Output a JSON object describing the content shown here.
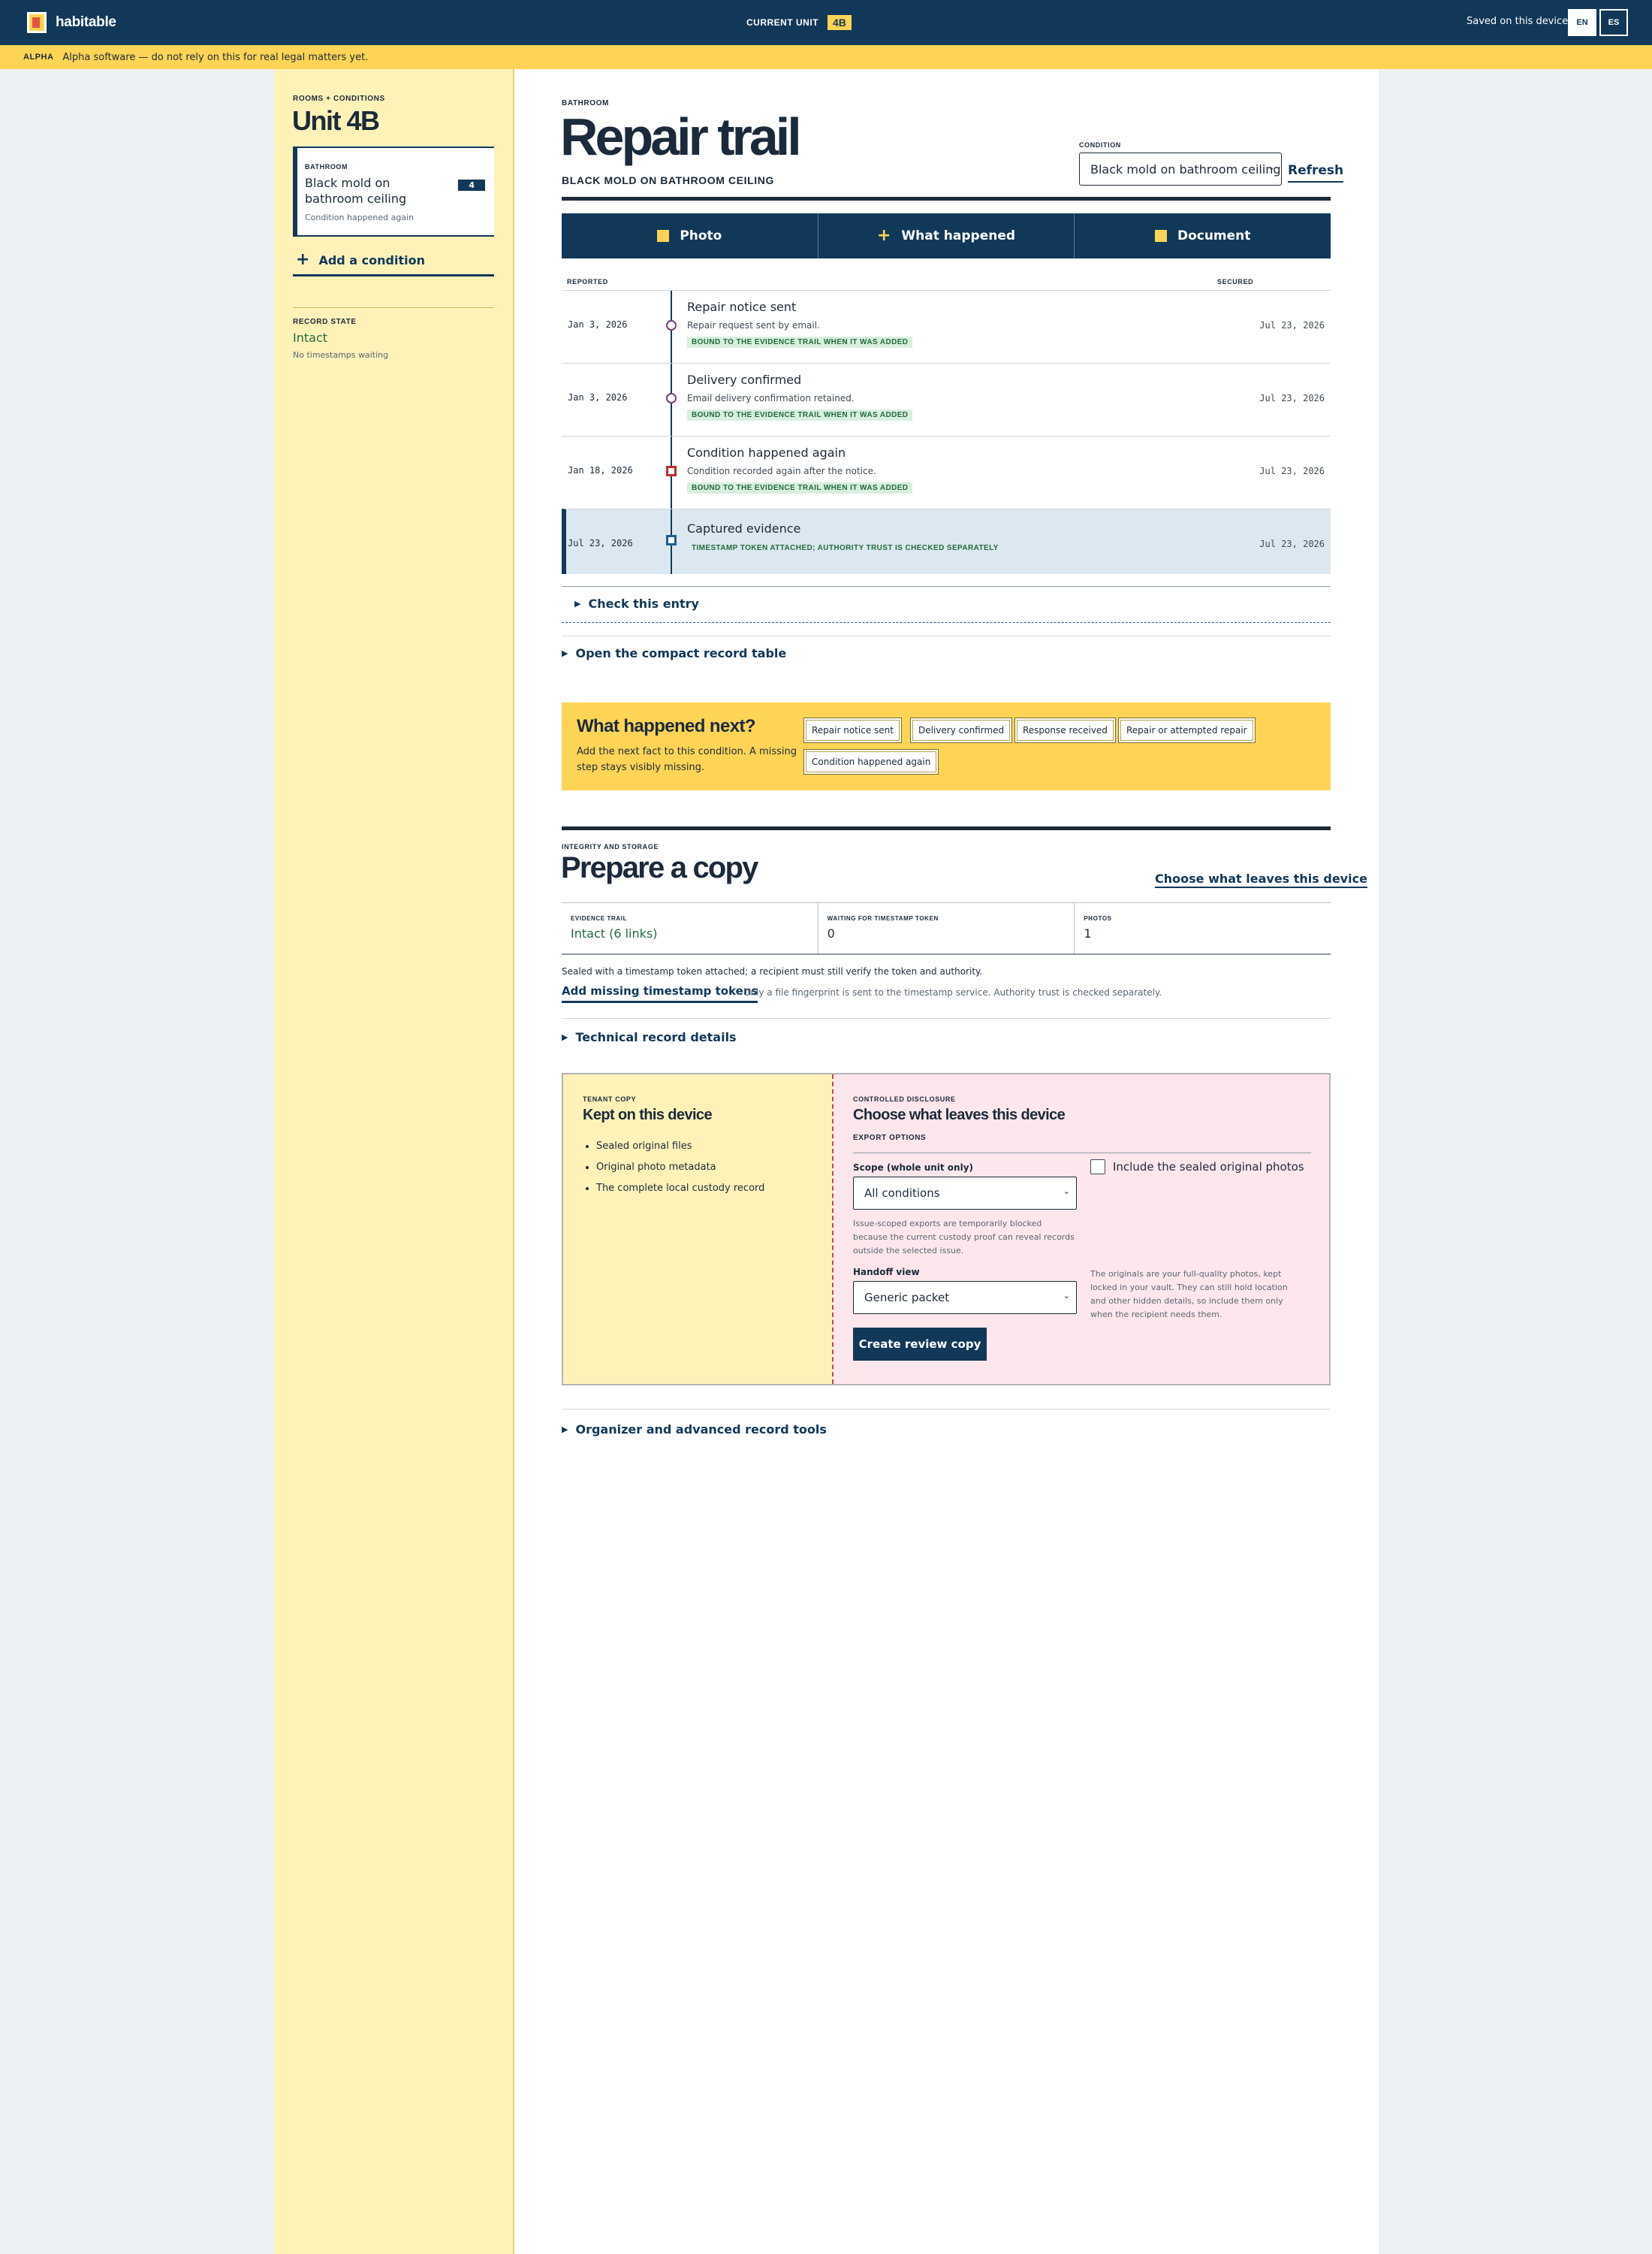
{
  "topbar": {
    "brand": "habitable",
    "current_unit_label": "CURRENT UNIT",
    "current_unit": "4B",
    "saved": "Saved on this device",
    "lang_en": "EN",
    "lang_es": "ES"
  },
  "alpha": {
    "tag": "ALPHA",
    "message": "Alpha software — do not rely on this for real legal matters yet."
  },
  "sidebar": {
    "eyebrow": "ROOMS + CONDITIONS",
    "unit_title": "Unit 4B",
    "condition_card": {
      "room": "BATHROOM",
      "title": "Black mold on bathroom ceiling",
      "status": "Condition happened again",
      "count": "4"
    },
    "add_condition": "Add a condition",
    "record_state_label": "RECORD STATE",
    "record_state": "Intact",
    "record_note": "No timestamps waiting"
  },
  "main": {
    "eyebrow": "BATHROOM",
    "title": "Repair trail",
    "subtitle": "BLACK MOLD ON BATHROOM CEILING",
    "condition_label": "CONDITION",
    "condition_value": "Black mold on bathroom ceiling",
    "refresh": "Refresh",
    "actions": {
      "photo": "Photo",
      "what_happened": "What happened",
      "document": "Document"
    },
    "timeline_headers": {
      "reported": "REPORTED",
      "secured": "SECURED"
    },
    "timeline": [
      {
        "date": "Jan 3, 2026",
        "title": "Repair notice sent",
        "desc": "Repair request sent by email.",
        "badge": "BOUND TO THE EVIDENCE TRAIL WHEN IT WAS ADDED",
        "secured": "Jul 23, 2026"
      },
      {
        "date": "Jan 3, 2026",
        "title": "Delivery confirmed",
        "desc": "Email delivery confirmation retained.",
        "badge": "BOUND TO THE EVIDENCE TRAIL WHEN IT WAS ADDED",
        "secured": "Jul 23, 2026"
      },
      {
        "date": "Jan 18, 2026",
        "title": "Condition happened again",
        "desc": "Condition recorded again after the notice.",
        "badge": "BOUND TO THE EVIDENCE TRAIL WHEN IT WAS ADDED",
        "secured": "Jul 23, 2026"
      },
      {
        "date": "Jul 23, 2026",
        "title": "Captured evidence",
        "badge": "TIMESTAMP TOKEN ATTACHED; AUTHORITY TRUST IS CHECKED SEPARATELY",
        "secured": "Jul 23, 2026"
      }
    ],
    "check_entry": "Check this entry",
    "compact_table": "Open the compact record table"
  },
  "next": {
    "title": "What happened next?",
    "body": "Add the next fact to this condition. A missing step stays visibly missing.",
    "chips": [
      "Repair notice sent",
      "Delivery confirmed",
      "Response received",
      "Repair or attempted repair",
      "Condition happened again"
    ]
  },
  "copy": {
    "eyebrow": "INTEGRITY AND STORAGE",
    "title": "Prepare a copy",
    "choose_link": "Choose what leaves this device",
    "stats": [
      {
        "label": "EVIDENCE TRAIL",
        "value": "Intact (6 links)"
      },
      {
        "label": "WAITING FOR TIMESTAMP TOKEN",
        "value": "0"
      },
      {
        "label": "PHOTOS",
        "value": "1"
      }
    ],
    "sealed_note": "Sealed with a timestamp token attached; a recipient must still verify the token and authority.",
    "add_tokens": "Add missing timestamp tokens",
    "tokens_note": "Only a file fingerprint is sent to the timestamp service. Authority trust is checked separately.",
    "technical": "Technical record details",
    "tenant": {
      "eyebrow": "TENANT COPY",
      "title": "Kept on this device",
      "items": [
        "Sealed original files",
        "Original photo metadata",
        "The complete local custody record"
      ]
    },
    "controlled": {
      "eyebrow": "CONTROLLED DISCLOSURE",
      "title": "Choose what leaves this device",
      "export_options": "EXPORT OPTIONS",
      "scope_label": "Scope (whole unit only)",
      "scope_value": "All conditions",
      "scope_note": "Issue-scoped exports are temporarily blocked because the current custody proof can reveal records outside the selected issue.",
      "handoff_label": "Handoff view",
      "handoff_value": "Generic packet",
      "create_button": "Create review copy",
      "include_originals": "Include the sealed original photos",
      "originals_note": "The originals are your full-quality photos, kept locked in your vault. They can still hold location and other hidden details, so include them only when the recipient needs them."
    },
    "organizer": "Organizer and advanced record tools"
  }
}
